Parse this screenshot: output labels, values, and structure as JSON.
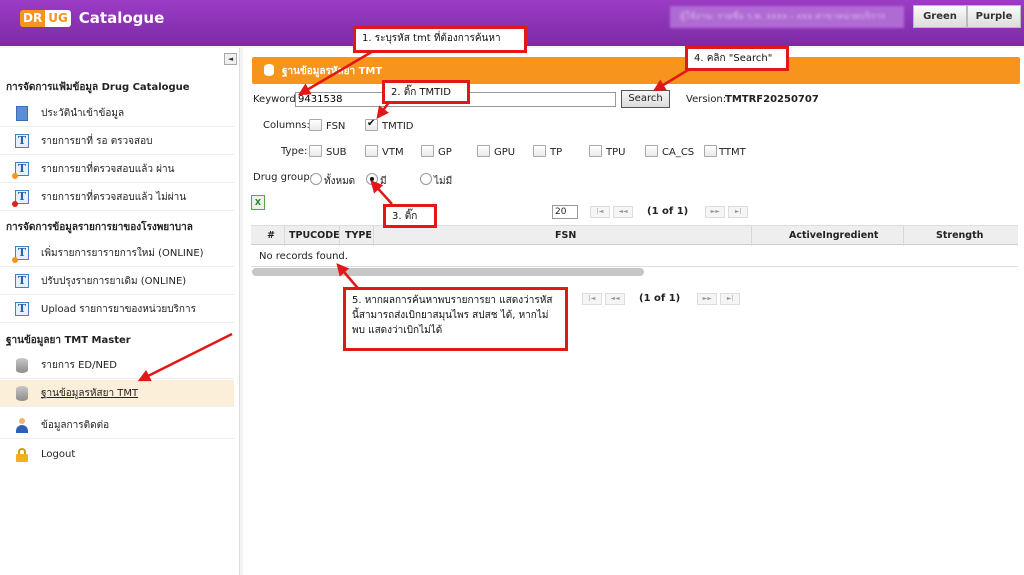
{
  "header": {
    "logo_dr": "DR",
    "logo_ug": "UG",
    "logo_text": "Catalogue",
    "user_info": "ผู้ใช้งาน: รายชื่อ ร.พ. xxxx - xxx สาขาหน่วยบริการ",
    "theme_green": "Green",
    "theme_purple": "Purple"
  },
  "sidebar": {
    "collapse": "◄",
    "sections": [
      {
        "title": "การจัดการแฟ้มข้อมูล Drug Catalogue",
        "items": [
          {
            "label": "ประวัตินำเข้าข้อมูล",
            "icon": "document-icon"
          },
          {
            "label": "รายการยาที่ รอ ตรวจสอบ",
            "icon": "tmt-pending-icon"
          },
          {
            "label": "รายการยาที่ตรวจสอบแล้ว ผ่าน",
            "icon": "tmt-passed-icon"
          },
          {
            "label": "รายการยาที่ตรวจสอบแล้ว ไม่ผ่าน",
            "icon": "tmt-failed-icon"
          }
        ]
      },
      {
        "title": "การจัดการข้อมูลรายการยาของโรงพยาบาล",
        "items": [
          {
            "label": "เพิ่มรายการยารายการใหม่ (ONLINE)",
            "icon": "tmt-add-icon"
          },
          {
            "label": "ปรับปรุงรายการยาเดิม (ONLINE)",
            "icon": "tmt-edit-icon"
          },
          {
            "label": "Upload รายการยาของหน่วยบริการ",
            "icon": "tmt-upload-icon"
          }
        ]
      },
      {
        "title": "ฐานข้อมูลยา TMT Master",
        "items": [
          {
            "label": "รายการ ED/NED",
            "icon": "database-icon"
          },
          {
            "label": "ฐานข้อมูลรหัสยา TMT",
            "icon": "database-icon",
            "active": true
          },
          {
            "label": "ข้อมูลการติดต่อ",
            "icon": "user-icon"
          },
          {
            "label": "Logout",
            "icon": "lock-icon"
          }
        ]
      }
    ]
  },
  "panel": {
    "title": "ฐานข้อมูลรหัสยา TMT"
  },
  "search": {
    "keyword_label": "Keyword:",
    "keyword_value": "9431538",
    "button": "Search",
    "version_label": "Version:",
    "version_value": "TMTRF20250707"
  },
  "columns": {
    "label": "Columns:",
    "options": [
      {
        "label": "FSN",
        "checked": false
      },
      {
        "label": "TMTID",
        "checked": true
      }
    ]
  },
  "type": {
    "label": "Type:",
    "options": [
      "SUB",
      "VTM",
      "GP",
      "GPU",
      "TP",
      "TPU",
      "CA_CS",
      "TTMT"
    ]
  },
  "drug_group": {
    "label": "Drug group:",
    "options": [
      {
        "label": "ทั้งหมด",
        "checked": false
      },
      {
        "label": "มี",
        "checked": true
      },
      {
        "label": "ไม่มี",
        "checked": false
      }
    ]
  },
  "pager": {
    "page_size": "20",
    "info": "(1 of 1)",
    "first": "|◄",
    "prev": "◄◄",
    "next": "►►",
    "last": "►|"
  },
  "grid": {
    "columns": [
      "#",
      "TPUCODE",
      "TYPE",
      "FSN",
      "ActiveIngredient",
      "Strength"
    ],
    "empty_text": "No records found."
  },
  "annotations": {
    "step1": "1. ระบุรหัส tmt ที่ต้องการค้นหา",
    "step2": "2. ติ๊ก TMTID",
    "step3": "3. ติ๊ก",
    "step4": "4. คลิก \"Search\"",
    "step5": "5. หากผลการค้นหาพบรายการยา แสดงว่ารหัสนี้สามารถส่งเบิกยาสมุนไพร สปสช ได้, หากไม่พบ แสดงว่าเบิกไม่ได้"
  },
  "colors": {
    "header": "#8a31b5",
    "panel": "#f7941d",
    "annotation_border": "#e21818"
  }
}
